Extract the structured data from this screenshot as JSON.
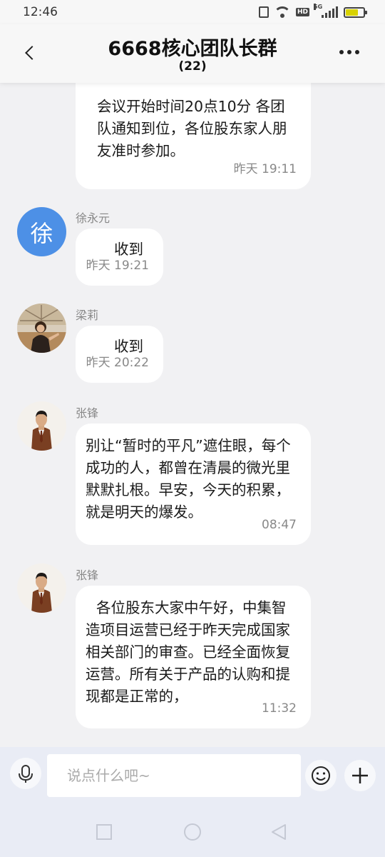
{
  "status_bar": {
    "time": "12:46",
    "icons": [
      "vibrate-icon",
      "wifi-icon",
      "hd-icon",
      "5g-signal-icon",
      "battery-icon"
    ],
    "hd_label": "HD",
    "network_label": "5G"
  },
  "header": {
    "title": "6668核心团队长群",
    "member_count": "(22)"
  },
  "messages": [
    {
      "sender": "",
      "avatar": "",
      "text": "会议开始时间20点10分 各团队通知到位，各位股东家人朋友准时参加。",
      "time": "昨天 19:11"
    },
    {
      "sender": "徐永元",
      "avatar": "徐",
      "text": "收到",
      "time": "昨天 19:21"
    },
    {
      "sender": "梁莉",
      "avatar": "photo",
      "text": "收到",
      "time": "昨天 20:22"
    },
    {
      "sender": "张锋",
      "avatar": "photo",
      "text": "别让“暂时的平凡”遮住眼，每个成功的人，都曾在清晨的微光里默默扎根。早安，今天的积累，就是明天的爆发。",
      "time": "08:47"
    },
    {
      "sender": "张锋",
      "avatar": "photo",
      "text": "各位股东大家中午好，中集智造项目运营已经于昨天完成国家相关部门的审查。已经全面恢复运营。所有关于产品的认购和提现都是正常的，",
      "time": "11:32"
    }
  ],
  "input": {
    "placeholder": "说点什么吧~",
    "value": ""
  },
  "nav": [
    "recent-apps-icon",
    "home-icon",
    "back-icon"
  ],
  "colors": {
    "page_bg": "#f1f1f3",
    "header_bg": "#f7f7f7",
    "bubble_bg": "#ffffff",
    "avatar_blue": "#4d90e6",
    "input_area_bg": "#e9ecf5"
  }
}
